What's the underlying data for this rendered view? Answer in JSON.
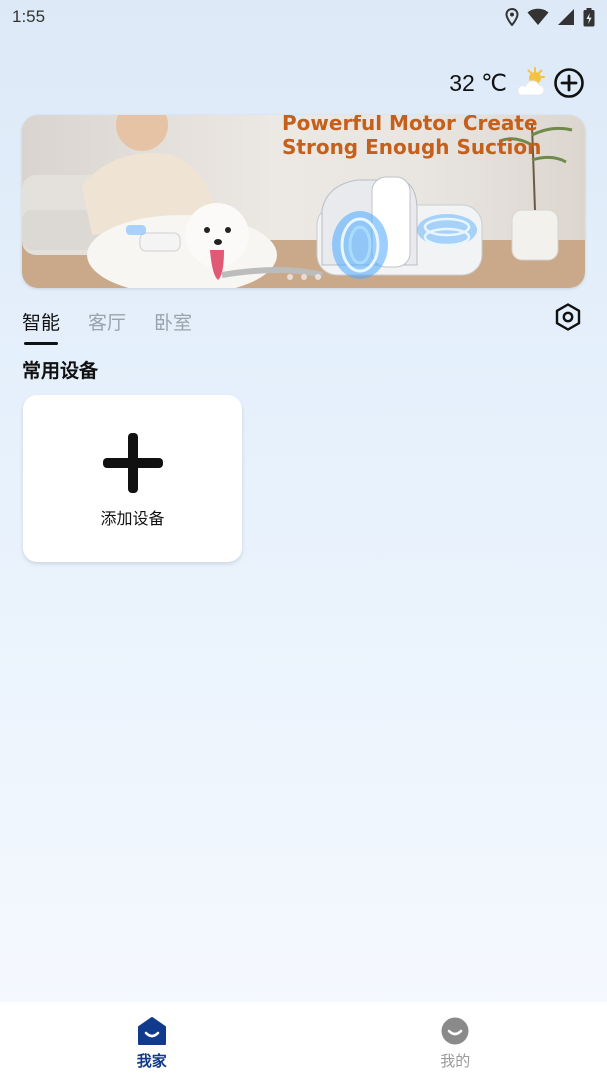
{
  "status_bar": {
    "time": "1:55",
    "icons": [
      "location-icon",
      "wifi-icon",
      "signal-icon",
      "battery-icon"
    ]
  },
  "header": {
    "temperature": "32 ℃",
    "weather_icon": "partly-sunny-icon",
    "add_icon": "add-circle-icon"
  },
  "banner": {
    "headline_line1": "Powerful Motor Create",
    "headline_line2": "Strong Enough Suction",
    "page_indicator_count": 3
  },
  "tabs": [
    {
      "label": "智能",
      "active": true
    },
    {
      "label": "客厅",
      "active": false
    },
    {
      "label": "卧室",
      "active": false
    }
  ],
  "settings_icon": "hexagon-settings-icon",
  "section": {
    "title": "常用设备"
  },
  "add_device": {
    "label": "添加设备",
    "icon": "plus-icon"
  },
  "bottom_nav": [
    {
      "label": "我家",
      "icon": "home-icon",
      "active": true
    },
    {
      "label": "我的",
      "icon": "profile-icon",
      "active": false
    }
  ],
  "colors": {
    "accent": "#123a8c",
    "banner_text": "#c4601c",
    "inactive": "#9aa3ad"
  }
}
